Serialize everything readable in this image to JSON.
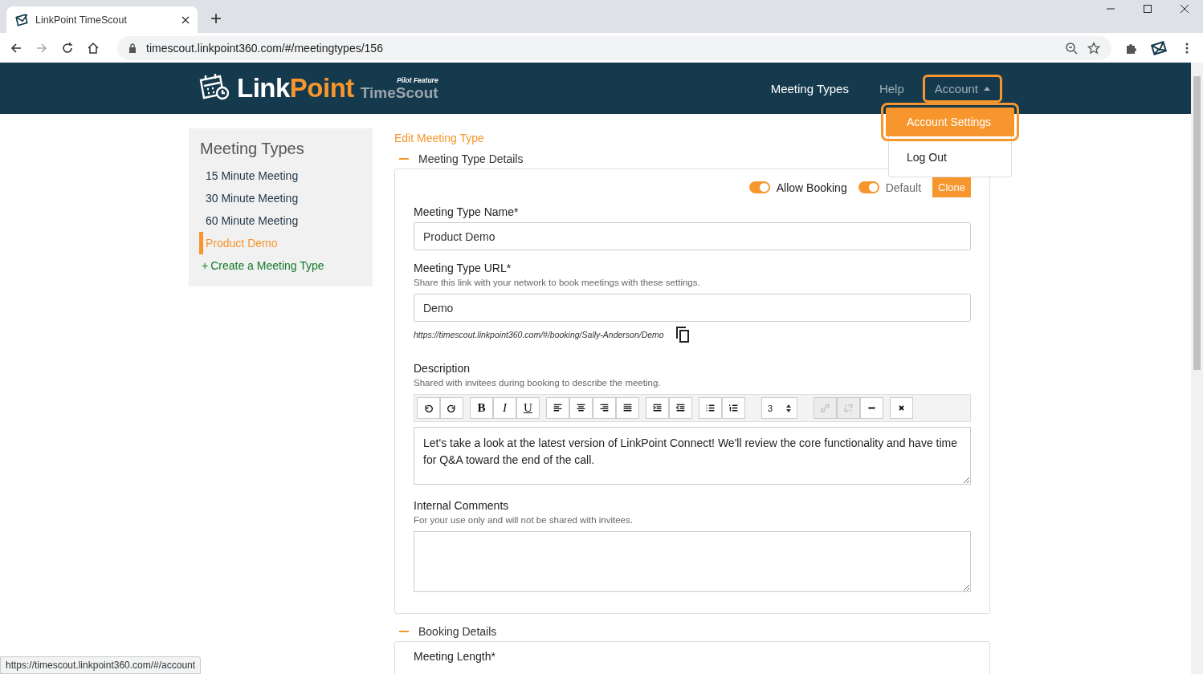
{
  "browser": {
    "tab_title": "LinkPoint TimeScout",
    "new_tab": "+",
    "address": "timescout.linkpoint360.com/#/meetingtypes/156",
    "status_link": "https://timescout.linkpoint360.com/#/account"
  },
  "header": {
    "logo_link": "Link",
    "logo_point": "Point",
    "logo_product": "TimeScout",
    "logo_badge": "Pilot Feature",
    "nav": [
      {
        "label": "Meeting Types",
        "kind": "link",
        "expanded": false
      },
      {
        "label": "Help",
        "kind": "link",
        "expanded": false
      },
      {
        "label": "Account",
        "kind": "dropdown",
        "expanded": true
      }
    ],
    "dropdown": [
      {
        "label": "Account Settings",
        "selected": true
      },
      {
        "label": "Log Out",
        "selected": false
      }
    ]
  },
  "sidebar": {
    "title": "Meeting Types",
    "items": [
      {
        "label": "15 Minute Meeting",
        "selected": false
      },
      {
        "label": "30 Minute Meeting",
        "selected": false
      },
      {
        "label": "60 Minute Meeting",
        "selected": false
      },
      {
        "label": "Product Demo",
        "selected": true
      }
    ],
    "create": {
      "icon": "+",
      "label": "Create a Meeting Type"
    }
  },
  "main": {
    "breadcrumb": "Edit Meeting Type",
    "section": "Meeting Type Details",
    "toggles": [
      {
        "label": "Allow Booking",
        "on": true
      },
      {
        "label": "Default",
        "on": true
      }
    ],
    "clone": "Clone",
    "name_field": {
      "label": "Meeting Type Name*",
      "value": "Product Demo"
    },
    "url_field": {
      "label": "Meeting Type URL*",
      "hint": "Share this link with your network to book meetings with these settings.",
      "value": "Demo",
      "link": "https://timescout.linkpoint360.com/#/booking/Sally-Anderson/Demo"
    },
    "description": {
      "label": "Description",
      "hint": "Shared with invitees during booking to describe the meeting.",
      "toolbar": [
        [
          {
            "disabled": false
          },
          {
            "disabled": false
          }
        ],
        [
          {
            "label": "B",
            "disabled": false
          },
          {
            "label": "I",
            "disabled": false
          },
          {
            "label": "U",
            "disabled": false
          }
        ],
        [
          {
            "disabled": false
          },
          {
            "disabled": false
          },
          {
            "disabled": false
          },
          {
            "disabled": false
          }
        ],
        [
          {
            "disabled": false
          },
          {
            "disabled": false
          }
        ],
        [
          {
            "disabled": false
          },
          {
            "disabled": false
          }
        ],
        [
          {
            "label": "3",
            "disabled": false
          }
        ],
        [
          {
            "disabled": true
          },
          {
            "disabled": true
          },
          {
            "disabled": false
          }
        ],
        [
          {
            "disabled": false
          }
        ]
      ],
      "value": "Let's take a look at the latest version of LinkPoint Connect! We'll review the core functionality and have time for Q&A toward the end of the call."
    },
    "comments": {
      "label": "Internal Comments",
      "hint": "For your use only and will not be shared with invitees."
    },
    "booking_section": "Booking Details",
    "booking_first_label": "Meeting Length*"
  }
}
